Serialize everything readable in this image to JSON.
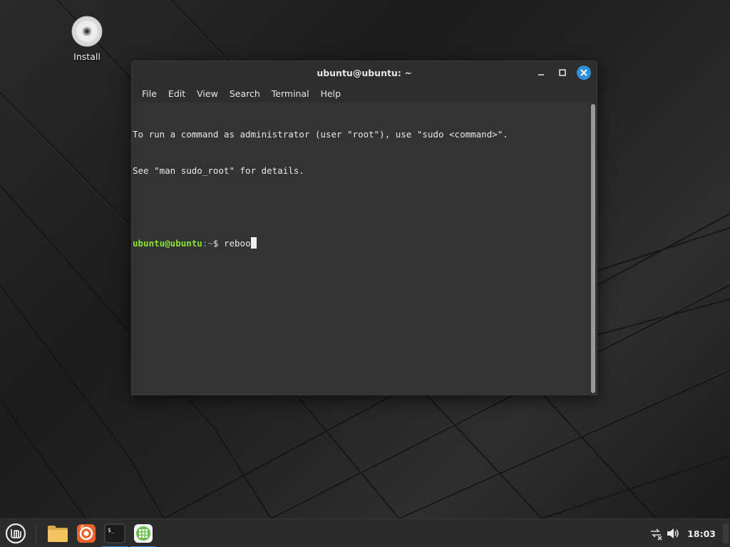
{
  "desktop": {
    "icons": [
      {
        "label": "Install",
        "icon": "disc-icon"
      }
    ]
  },
  "terminal_window": {
    "title": "ubuntu@ubuntu: ~",
    "menu": [
      "File",
      "Edit",
      "View",
      "Search",
      "Terminal",
      "Help"
    ],
    "output_lines": [
      "To run a command as administrator (user \"root\"), use \"sudo <command>\".",
      "See \"man sudo_root\" for details."
    ],
    "prompt": {
      "user_host": "ubuntu@ubuntu",
      "path": ":~",
      "symbol": "$ ",
      "command": "reboo"
    }
  },
  "taskbar": {
    "menu_icon": "mint-menu-icon",
    "apps": [
      {
        "name": "files-icon",
        "active": false
      },
      {
        "name": "firefox-icon",
        "active": false
      },
      {
        "name": "terminal-icon",
        "active": true
      },
      {
        "name": "calculator-icon",
        "active": true
      }
    ],
    "tray": {
      "network_icon": "network-disconnected-icon",
      "volume_icon": "volume-icon",
      "clock": "18:03"
    }
  },
  "colors": {
    "accent": "#3584e4",
    "close_button": "#2f8fd8",
    "prompt_user": "#8ae234",
    "prompt_path": "#8a9fc4"
  }
}
